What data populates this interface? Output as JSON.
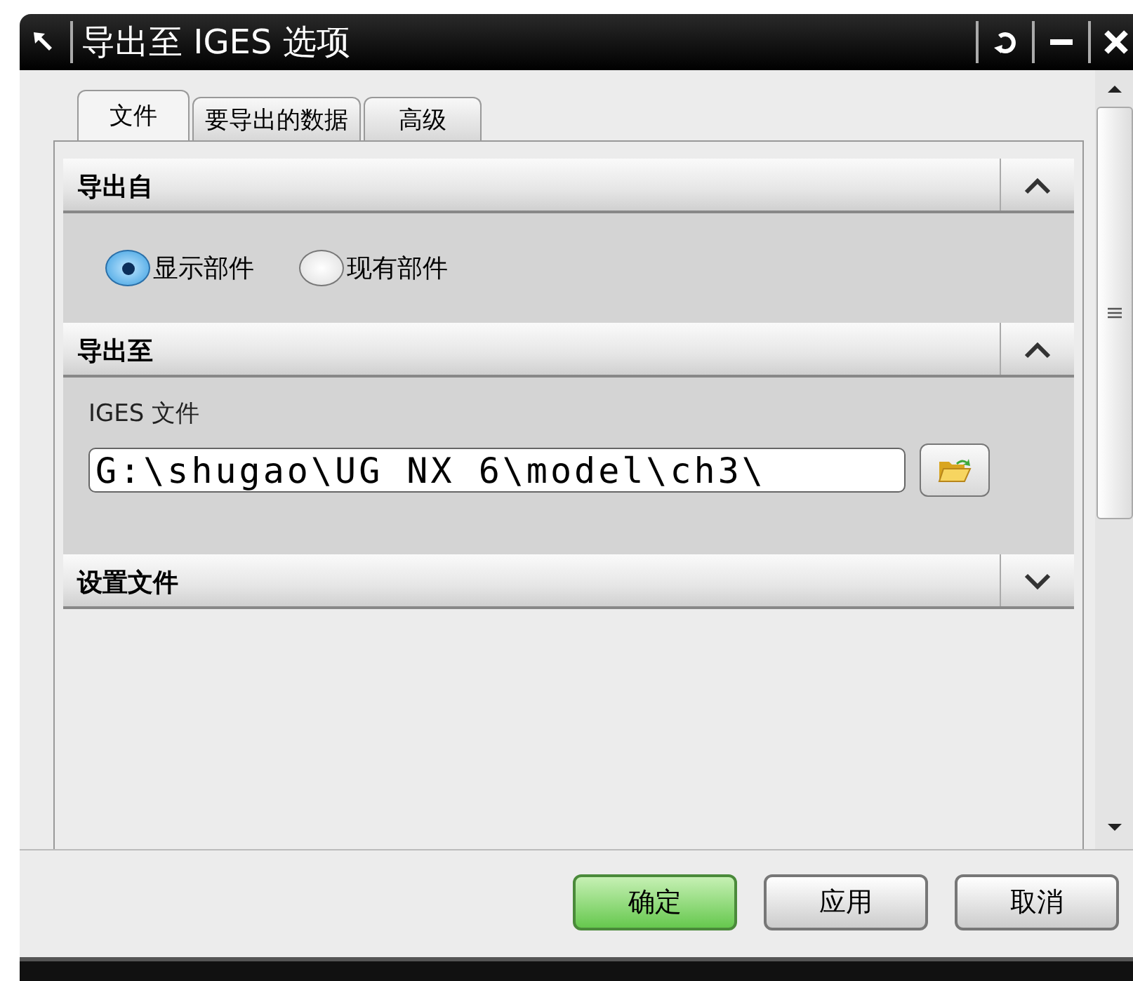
{
  "window": {
    "title": "导出至 IGES 选项"
  },
  "tabs": [
    {
      "label": "文件",
      "selected": true
    },
    {
      "label": "要导出的数据",
      "selected": false
    },
    {
      "label": "高级",
      "selected": false
    }
  ],
  "sections": [
    {
      "title": "导出自",
      "expanded": true,
      "kind": "radio",
      "options": [
        {
          "label": "显示部件",
          "selected": true
        },
        {
          "label": "现有部件",
          "selected": false
        }
      ]
    },
    {
      "title": "导出至",
      "expanded": true,
      "kind": "file",
      "field_label": "IGES 文件",
      "value": "G:\\shugao\\UG NX 6\\model\\ch3\\"
    },
    {
      "title": "设置文件",
      "expanded": false
    }
  ],
  "buttons": [
    {
      "label": "确定",
      "default": true
    },
    {
      "label": "应用",
      "default": false
    },
    {
      "label": "取消",
      "default": false
    }
  ]
}
